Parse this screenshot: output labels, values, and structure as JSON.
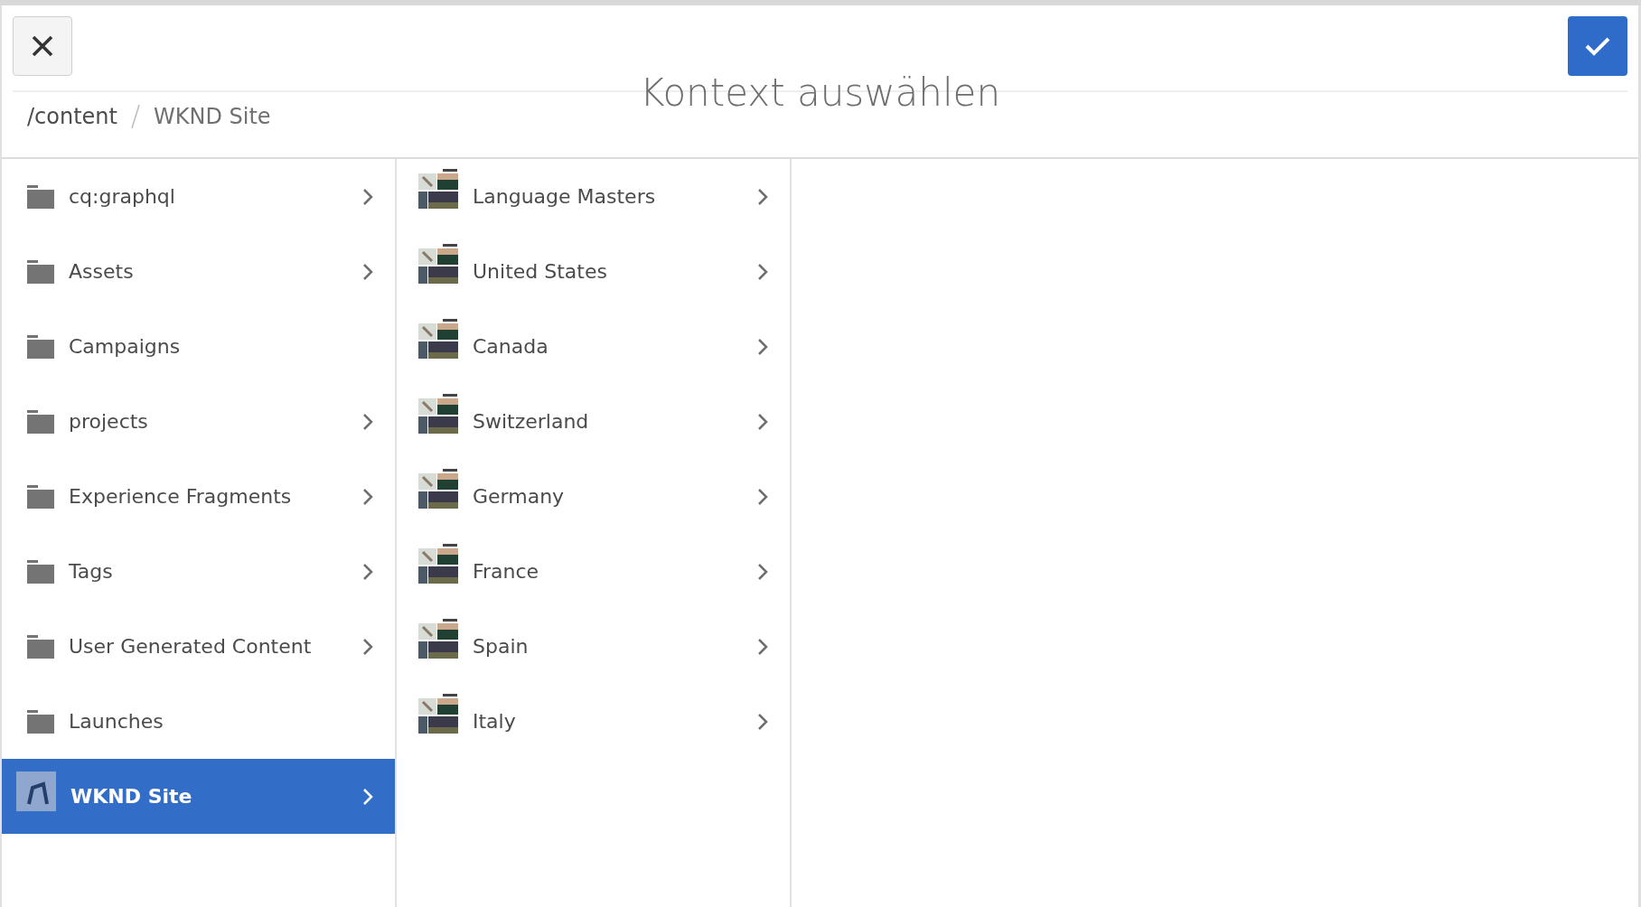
{
  "dialog": {
    "title": "Kontext auswählen"
  },
  "breadcrumb": [
    "/content",
    "WKND Site"
  ],
  "columns": [
    {
      "items": [
        {
          "label": "cq:graphql",
          "kind": "folder",
          "has_children": true,
          "selected": false
        },
        {
          "label": "Assets",
          "kind": "folder",
          "has_children": true,
          "selected": false
        },
        {
          "label": "Campaigns",
          "kind": "folder",
          "has_children": false,
          "selected": false
        },
        {
          "label": "projects",
          "kind": "folder",
          "has_children": true,
          "selected": false
        },
        {
          "label": "Experience Fragments",
          "kind": "folder",
          "has_children": true,
          "selected": false
        },
        {
          "label": "Tags",
          "kind": "folder",
          "has_children": true,
          "selected": false
        },
        {
          "label": "User Generated Content",
          "kind": "folder",
          "has_children": true,
          "selected": false
        },
        {
          "label": "Launches",
          "kind": "folder",
          "has_children": false,
          "selected": false
        },
        {
          "label": "WKND Site",
          "kind": "site",
          "has_children": true,
          "selected": true
        }
      ]
    },
    {
      "items": [
        {
          "label": "Language Masters",
          "kind": "page",
          "has_children": true,
          "selected": false
        },
        {
          "label": "United States",
          "kind": "page",
          "has_children": true,
          "selected": false
        },
        {
          "label": "Canada",
          "kind": "page",
          "has_children": true,
          "selected": false
        },
        {
          "label": "Switzerland",
          "kind": "page",
          "has_children": true,
          "selected": false
        },
        {
          "label": "Germany",
          "kind": "page",
          "has_children": true,
          "selected": false
        },
        {
          "label": "France",
          "kind": "page",
          "has_children": true,
          "selected": false
        },
        {
          "label": "Spain",
          "kind": "page",
          "has_children": true,
          "selected": false
        },
        {
          "label": "Italy",
          "kind": "page",
          "has_children": true,
          "selected": false
        }
      ]
    },
    {}
  ]
}
